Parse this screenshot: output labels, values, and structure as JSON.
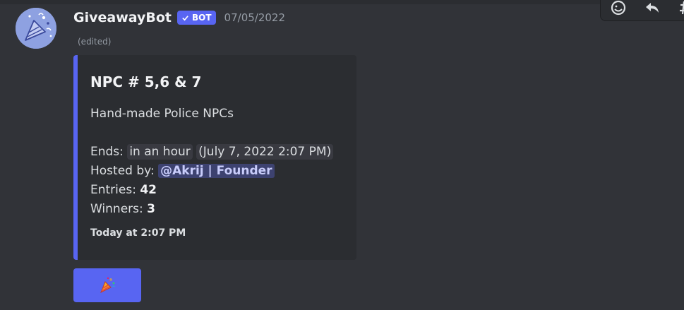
{
  "message": {
    "username": "GiveawayBot",
    "bot_badge": "BOT",
    "timestamp": "07/05/2022",
    "edited": "(edited)",
    "avatar_icon": "party-popper-icon"
  },
  "embed": {
    "accent_color": "#5865f2",
    "title": "NPC # 5,6 & 7",
    "description": "Hand-made Police NPCs",
    "ends_label": "Ends:",
    "ends_relative": "in an hour",
    "ends_absolute": "July 7, 2022 2:07 PM",
    "hosted_label": "Hosted by:",
    "host_mention": "@Akrij | Founder",
    "entries_label": "Entries:",
    "entries_value": "42",
    "winners_label": "Winners:",
    "winners_value": "3",
    "footer": "Today at 2:07 PM"
  },
  "button": {
    "icon": "party-popper-icon",
    "color": "#5865f2"
  },
  "toolbar": {
    "icons": [
      "add-reaction-icon",
      "reply-icon",
      "hash-icon"
    ]
  }
}
